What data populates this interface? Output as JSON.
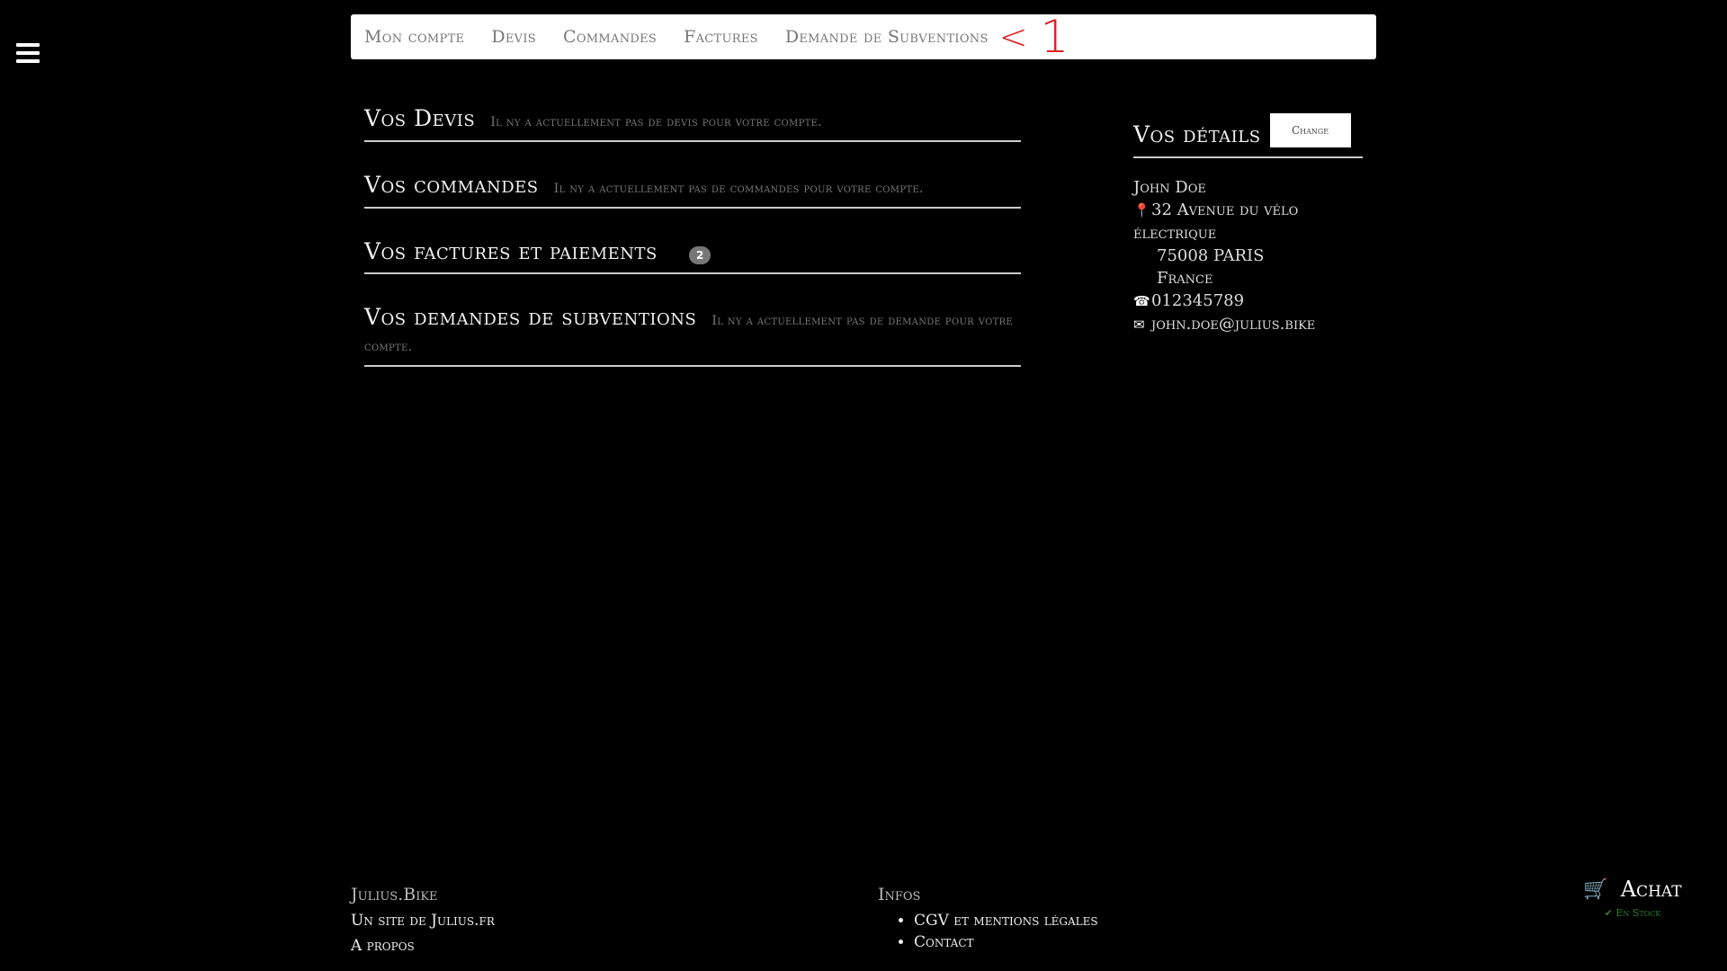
{
  "nav": {
    "items": [
      {
        "label": "Mon compte"
      },
      {
        "label": "Devis"
      },
      {
        "label": "Commandes"
      },
      {
        "label": "Factures"
      },
      {
        "label": "Demande de Subventions"
      }
    ],
    "annotation_arrow": "<",
    "annotation_number": "1"
  },
  "sections": {
    "devis": {
      "title": "Vos Devis",
      "note": "Il ny a actuellement pas de devis pour votre compte."
    },
    "commandes": {
      "title": "Vos commandes",
      "note": "Il ny a actuellement pas de commandes pour votre compte."
    },
    "factures": {
      "title": "Vos factures et paiements",
      "badge": "2"
    },
    "subventions": {
      "title": "Vos demandes de subventions",
      "note": "Il ny a actuellement pas de demande pour votre compte."
    }
  },
  "details": {
    "title": "Vos détails",
    "change_label": "Change",
    "name": "John Doe",
    "address_line1": "32 Avenue du vélo électrique",
    "address_line2": "75008 PARIS",
    "country": "France",
    "phone": "012345789",
    "email": "john.doe@julius.bike",
    "icons": {
      "address": "map-marker-icon",
      "phone": "phone-icon",
      "email": "envelope-icon"
    }
  },
  "footer": {
    "col1": {
      "heading": "Julius.Bike",
      "links": [
        "Un site de Julius.fr",
        "A propos"
      ]
    },
    "col2": {
      "heading": "Infos",
      "links": [
        "CGV et mentions légales",
        "Contact"
      ]
    }
  },
  "cart": {
    "label": "Achat",
    "stock": "En Stock",
    "stock_color": "#2e7d32"
  },
  "colors": {
    "background": "#000000",
    "nav_background": "#ffffff",
    "annotation": "#e02020"
  }
}
